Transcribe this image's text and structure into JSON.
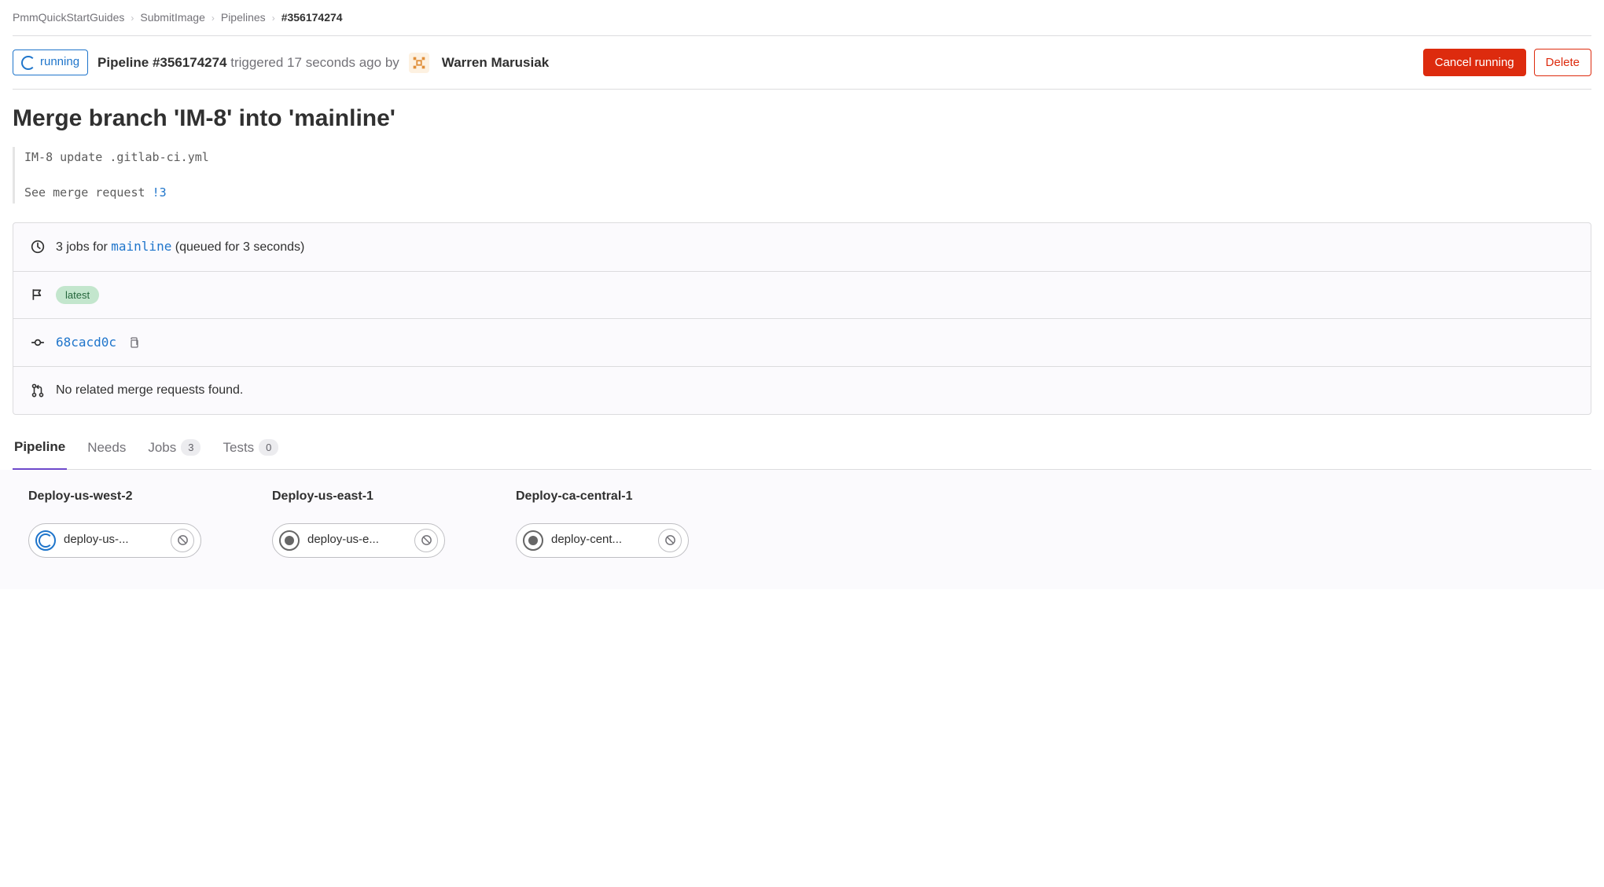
{
  "breadcrumbs": {
    "items": [
      "PmmQuickStartGuides",
      "SubmitImage",
      "Pipelines"
    ],
    "current": "#356174274"
  },
  "header": {
    "status_label": "running",
    "pipeline_prefix": "Pipeline ",
    "pipeline_id": "#356174274",
    "triggered_text": " triggered 17 seconds ago by",
    "username": "Warren Marusiak",
    "cancel_label": "Cancel running",
    "delete_label": "Delete"
  },
  "commit": {
    "title": "Merge branch 'IM-8' into 'mainline'",
    "body_line1": "IM-8 update .gitlab-ci.yml",
    "body_line2_prefix": "See merge request ",
    "body_mr_link": "!3"
  },
  "info": {
    "jobs_prefix": "3 jobs for ",
    "branch": "mainline",
    "queued_suffix": " (queued for 3 seconds)",
    "latest_label": "latest",
    "sha": "68cacd0c",
    "mr_text": "No related merge requests found."
  },
  "tabs": {
    "pipeline": "Pipeline",
    "needs": "Needs",
    "jobs": "Jobs",
    "jobs_count": "3",
    "tests": "Tests",
    "tests_count": "0"
  },
  "stages": [
    {
      "title": "Deploy-us-west-2",
      "job_name": "deploy-us-...",
      "status": "running"
    },
    {
      "title": "Deploy-us-east-1",
      "job_name": "deploy-us-e...",
      "status": "manual"
    },
    {
      "title": "Deploy-ca-central-1",
      "job_name": "deploy-cent...",
      "status": "manual"
    }
  ]
}
